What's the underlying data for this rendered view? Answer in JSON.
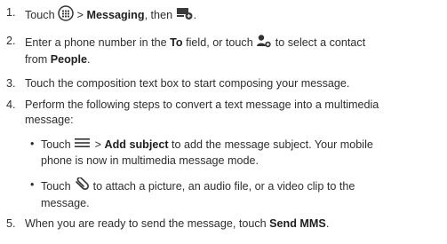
{
  "steps": [
    {
      "num": "1.",
      "t1": "Touch ",
      "t2": " > ",
      "b1": "Messaging",
      "t3": ", then ",
      "t4": ".",
      "icons": [
        "apps-grid-icon",
        "new-message-icon"
      ]
    },
    {
      "num": "2.",
      "t1": "Enter a phone number in the ",
      "b1": "To",
      "t2": " field, or touch ",
      "t3": " to select a contact",
      "t4": "from ",
      "b2": "People",
      "t5": ".",
      "icons": [
        "add-contact-icon"
      ]
    },
    {
      "num": "3.",
      "t1": "Touch the composition text box to start composing your message."
    },
    {
      "num": "4.",
      "t1": "Perform the following steps to convert a text message into a multimedia",
      "t2": "message:"
    },
    {
      "num": "5.",
      "t1": "When you are ready to send the message, touch ",
      "b1": "Send MMS",
      "t2": "."
    }
  ],
  "bullets": [
    {
      "dot": "•",
      "t1": "Touch ",
      "t2": " > ",
      "b1": "Add subject",
      "t3": " to add the message subject. Your mobile",
      "t4": "phone is now in multimedia message mode.",
      "icons": [
        "menu-icon"
      ]
    },
    {
      "dot": "•",
      "t1": "Touch ",
      "t2": " to attach a picture, an audio file, or a video clip to the",
      "t3": "message.",
      "icons": [
        "paperclip-icon"
      ]
    }
  ]
}
